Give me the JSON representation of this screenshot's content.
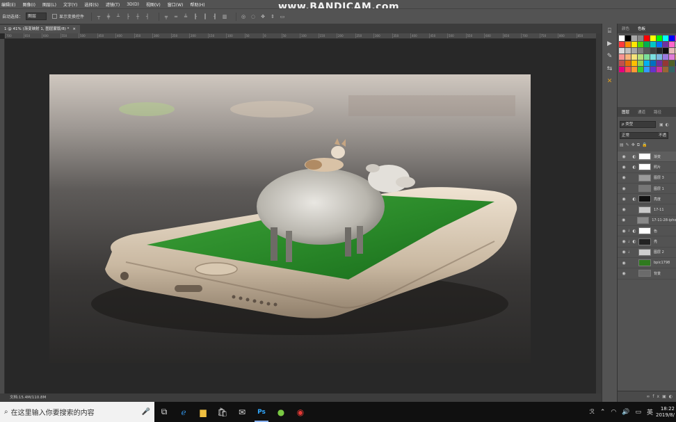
{
  "menubar": {
    "items": [
      "编辑(E)",
      "图像(I)",
      "图层(L)",
      "文字(Y)",
      "选择(S)",
      "滤镜(T)",
      "3D(D)",
      "视图(V)",
      "窗口(W)",
      "帮助(H)"
    ]
  },
  "watermark": "www.BANDICAM.com",
  "options": {
    "auto_select_label": "自动选择：",
    "auto_select_value": "图层",
    "show_transform_label": "显示变换控件"
  },
  "document_tab": {
    "title": "1 @ 41% (渐变映射 1, 图层蒙版/8) *",
    "close": "×"
  },
  "ruler_ticks": [
    "700",
    "650",
    "600",
    "550",
    "500",
    "450",
    "400",
    "350",
    "300",
    "250",
    "200",
    "150",
    "100",
    "50",
    "0",
    "50",
    "100",
    "150",
    "200",
    "250",
    "300",
    "350",
    "400",
    "450",
    "500",
    "550",
    "600",
    "650",
    "700",
    "750",
    "800",
    "850"
  ],
  "status": {
    "doc": "文档:15.4M/110.8M"
  },
  "panel_tabs": {
    "swatches_a": "颜色",
    "swatches_b": "色板"
  },
  "swatch_colors": [
    "#ffffff",
    "#000000",
    "#aaaaaa",
    "#888888",
    "#ff0000",
    "#ffff00",
    "#00ff00",
    "#00ffff",
    "#0000ff",
    "#ff00ff",
    "#ff3b3b",
    "#ff8a00",
    "#ffe600",
    "#54d600",
    "#00b050",
    "#00c6c6",
    "#0070ff",
    "#7030a0",
    "#ff66cc",
    "#c0c0c0",
    "#d9d9d9",
    "#bfbfbf",
    "#a6a6a6",
    "#7f7f7f",
    "#595959",
    "#404040",
    "#262626",
    "#0d0d0d",
    "#e6b8b7",
    "#fcd5b4",
    "#f79494",
    "#f7b37a",
    "#f7e37a",
    "#b7e07a",
    "#7ae09a",
    "#7adfe0",
    "#7ab7e0",
    "#9a7ae0",
    "#e07ad6",
    "#e0a07a",
    "#c0504d",
    "#e46c0a",
    "#ffc000",
    "#92d050",
    "#00b0f0",
    "#0070c0",
    "#7030a0",
    "#953735",
    "#4f6228",
    "#17375e",
    "#e6007e",
    "#ff4f4f",
    "#ff9933",
    "#33cc33",
    "#3399ff",
    "#6633cc",
    "#cc3399",
    "#996633",
    "#336666",
    "#663366"
  ],
  "layers_panel": {
    "tabs": [
      "图层",
      "通道",
      "路径"
    ],
    "filter": "ρ 类型",
    "blend_mode": "正常",
    "opacity": "不透",
    "layers": [
      {
        "name": "渐变",
        "thumb": "#ffffff",
        "adj": "◐",
        "clip": "",
        "selected": true
      },
      {
        "name": "照片",
        "thumb": "#ffffff",
        "adj": "◐",
        "clip": "",
        "selected": false
      },
      {
        "name": "图层 3",
        "thumb": "#9a9a9a",
        "adj": "",
        "clip": "",
        "selected": false
      },
      {
        "name": "图层 1",
        "thumb": "#777777",
        "adj": "",
        "clip": "",
        "selected": false
      },
      {
        "name": "亮度",
        "thumb": "#111111",
        "adj": "◐",
        "clip": "",
        "selected": false
      },
      {
        "name": "17-11",
        "thumb": "#c9c9c9",
        "adj": "",
        "clip": "",
        "selected": false
      },
      {
        "name": "17-11-28-iphon",
        "thumb": "#8a8a8a",
        "adj": "",
        "clip": "",
        "selected": false
      },
      {
        "name": "色",
        "thumb": "#ffffff",
        "adj": "◐",
        "clip": "↓",
        "selected": false
      },
      {
        "name": "亮",
        "thumb": "#222222",
        "adj": "◐",
        "clip": "↓",
        "selected": false
      },
      {
        "name": "图层 2",
        "thumb": "#cfcfcf",
        "adj": "",
        "clip": "↓",
        "selected": false
      },
      {
        "name": "bpic1798",
        "thumb": "#2f7a1e",
        "adj": "",
        "clip": "",
        "selected": false
      },
      {
        "name": "背景",
        "thumb": "#6b6b6b",
        "adj": "",
        "clip": "",
        "selected": false
      }
    ]
  },
  "taskbar": {
    "search_placeholder": "在这里输入你要搜索的内容",
    "time": "18:22",
    "date": "2019/8/",
    "ime": "英",
    "ai": "ℛ"
  }
}
